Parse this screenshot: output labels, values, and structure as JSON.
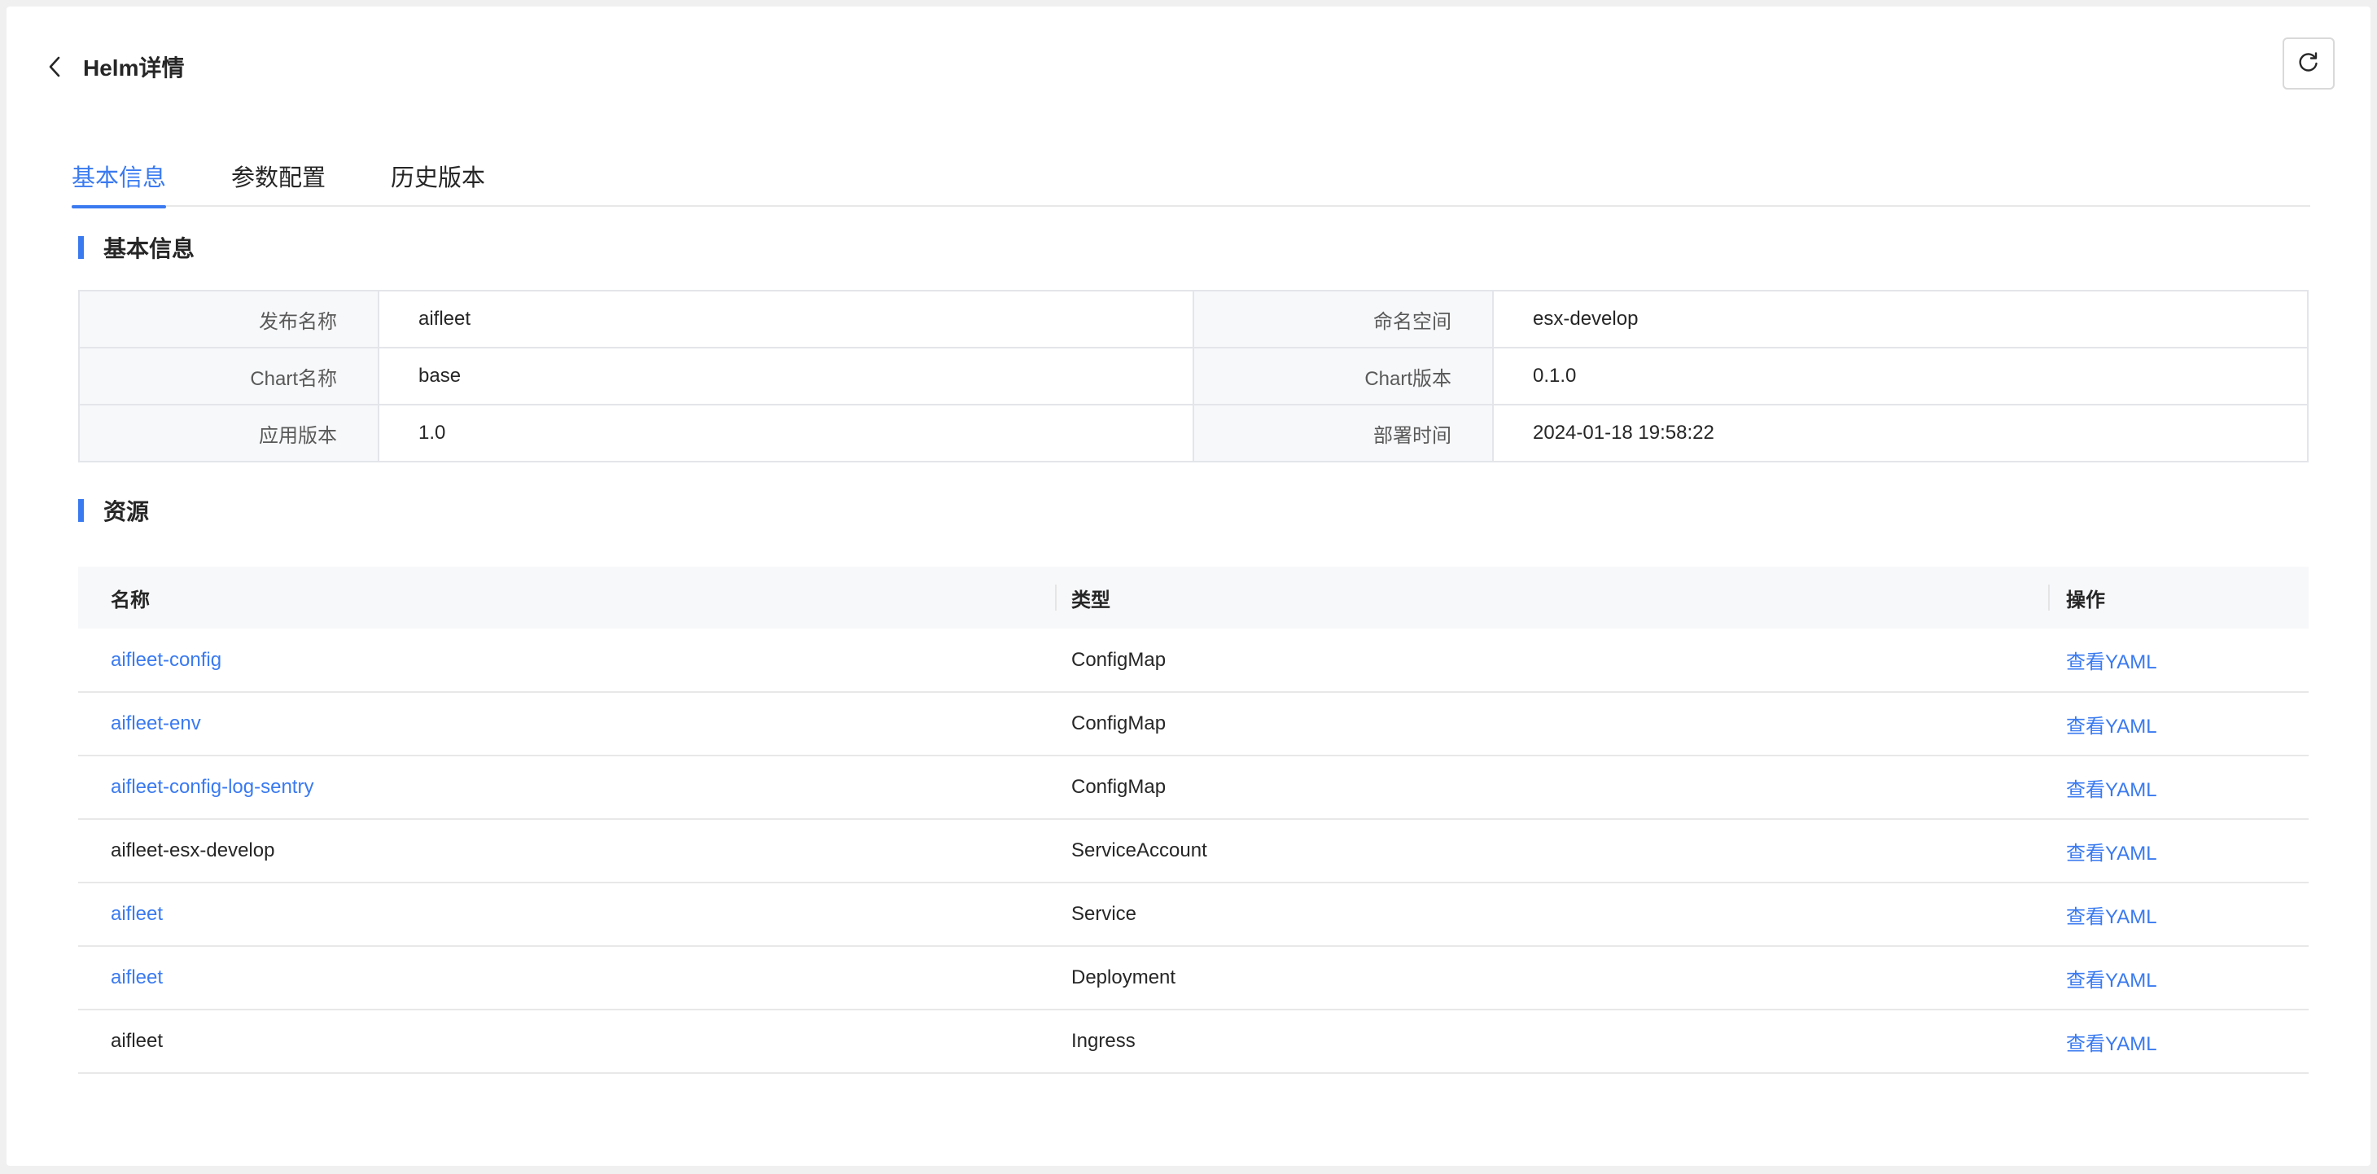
{
  "header": {
    "title": "Helm详情"
  },
  "tabs": [
    {
      "label": "基本信息",
      "active": true
    },
    {
      "label": "参数配置",
      "active": false
    },
    {
      "label": "历史版本",
      "active": false
    }
  ],
  "basic_info": {
    "section_title": "基本信息",
    "rows": [
      [
        {
          "label": "发布名称",
          "value": "aifleet"
        },
        {
          "label": "命名空间",
          "value": "esx-develop"
        }
      ],
      [
        {
          "label": "Chart名称",
          "value": "base"
        },
        {
          "label": "Chart版本",
          "value": "0.1.0"
        }
      ],
      [
        {
          "label": "应用版本",
          "value": "1.0"
        },
        {
          "label": "部署时间",
          "value": "2024-01-18 19:58:22"
        }
      ]
    ]
  },
  "resources": {
    "section_title": "资源",
    "columns": {
      "name": "名称",
      "type": "类型",
      "action": "操作"
    },
    "rows": [
      {
        "name": "aifleet-config",
        "type": "ConfigMap",
        "action": "查看YAML",
        "name_link": true
      },
      {
        "name": "aifleet-env",
        "type": "ConfigMap",
        "action": "查看YAML",
        "name_link": true
      },
      {
        "name": "aifleet-config-log-sentry",
        "type": "ConfigMap",
        "action": "查看YAML",
        "name_link": true
      },
      {
        "name": "aifleet-esx-develop",
        "type": "ServiceAccount",
        "action": "查看YAML",
        "name_link": false
      },
      {
        "name": "aifleet",
        "type": "Service",
        "action": "查看YAML",
        "name_link": true
      },
      {
        "name": "aifleet",
        "type": "Deployment",
        "action": "查看YAML",
        "name_link": true
      },
      {
        "name": "aifleet",
        "type": "Ingress",
        "action": "查看YAML",
        "name_link": false
      }
    ]
  },
  "icons": {
    "back": "chevron-left-icon",
    "refresh": "refresh-icon"
  },
  "colors": {
    "accent": "#3a7af0",
    "label_bg": "#f7f8fa",
    "border": "#e3e5ea"
  }
}
